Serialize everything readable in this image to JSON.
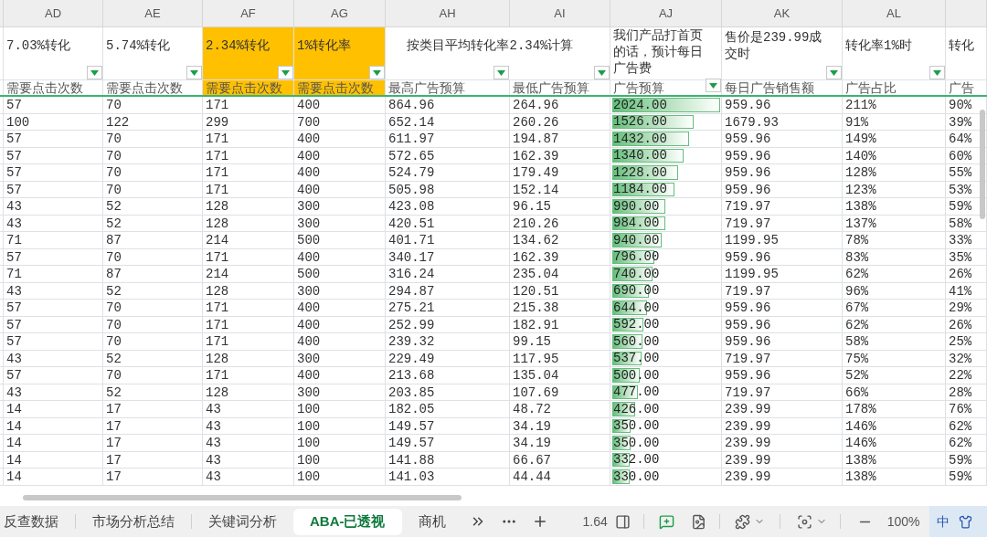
{
  "columns": [
    {
      "letter": "AD",
      "subheader": "需要点击次数",
      "filter": true,
      "highlighted": false,
      "kind": "text"
    },
    {
      "letter": "AE",
      "subheader": "需要点击次数",
      "filter": true,
      "highlighted": false,
      "kind": "text"
    },
    {
      "letter": "AF",
      "subheader": "需要点击次数",
      "filter": true,
      "highlighted": true,
      "kind": "text"
    },
    {
      "letter": "AG",
      "subheader": "需要点击次数",
      "filter": true,
      "highlighted": true,
      "kind": "text"
    },
    {
      "letter": "AH",
      "subheader": "最高广告预算",
      "filter": true,
      "highlighted": false,
      "kind": "text"
    },
    {
      "letter": "AI",
      "subheader": "最低广告预算",
      "filter": true,
      "highlighted": false,
      "kind": "text"
    },
    {
      "letter": "AJ",
      "subheader": "广告预算",
      "filter": true,
      "highlighted": false,
      "kind": "databar"
    },
    {
      "letter": "AK",
      "subheader": "每日广告销售额",
      "filter": true,
      "highlighted": false,
      "kind": "text"
    },
    {
      "letter": "AL",
      "subheader": "广告占比",
      "filter": true,
      "highlighted": false,
      "kind": "text"
    },
    {
      "subheader": "广告",
      "filter": false,
      "highlighted": false,
      "kind": "text"
    }
  ],
  "header_cells": [
    {
      "text": "7.03%转化",
      "kind": "single"
    },
    {
      "text": "5.74%转化",
      "kind": "single"
    },
    {
      "text": "2.34%转化",
      "kind": "single"
    },
    {
      "text": "1%转化率",
      "kind": "single"
    },
    {
      "text": "按类目平均转化率2.34%计算",
      "kind": "merged"
    },
    {
      "text": "我们产品打首页的话，预计每日广告费",
      "kind": "single"
    },
    {
      "text": "售价是239.99成交时",
      "kind": "single"
    },
    {
      "text": "转化率1%时",
      "kind": "single"
    },
    {
      "text": "转化",
      "kind": "single"
    }
  ],
  "rows": [
    [
      "57",
      "70",
      "171",
      "400",
      "864.96",
      "264.96",
      {
        "text": "2024.00",
        "level": 1.0
      },
      "959.96",
      "211%",
      "90%"
    ],
    [
      "100",
      "122",
      "299",
      "700",
      "652.14",
      "260.26",
      {
        "text": "1526.00",
        "level": 0.75
      },
      "1679.93",
      "91%",
      "39%"
    ],
    [
      "57",
      "70",
      "171",
      "400",
      "611.97",
      "194.87",
      {
        "text": "1432.00",
        "level": 0.71
      },
      "959.96",
      "149%",
      "64%"
    ],
    [
      "57",
      "70",
      "171",
      "400",
      "572.65",
      "162.39",
      {
        "text": "1340.00",
        "level": 0.66
      },
      "959.96",
      "140%",
      "60%"
    ],
    [
      "57",
      "70",
      "171",
      "400",
      "524.79",
      "179.49",
      {
        "text": "1228.00",
        "level": 0.61
      },
      "959.96",
      "128%",
      "55%"
    ],
    [
      "57",
      "70",
      "171",
      "400",
      "505.98",
      "152.14",
      {
        "text": "1184.00",
        "level": 0.58
      },
      "959.96",
      "123%",
      "53%"
    ],
    [
      "43",
      "52",
      "128",
      "300",
      "423.08",
      "96.15",
      {
        "text": "990.00",
        "level": 0.49
      },
      "719.97",
      "138%",
      "59%"
    ],
    [
      "43",
      "52",
      "128",
      "300",
      "420.51",
      "210.26",
      {
        "text": "984.00",
        "level": 0.49
      },
      "719.97",
      "137%",
      "58%"
    ],
    [
      "71",
      "87",
      "214",
      "500",
      "401.71",
      "134.62",
      {
        "text": "940.00",
        "level": 0.46
      },
      "1199.95",
      "78%",
      "33%"
    ],
    [
      "57",
      "70",
      "171",
      "400",
      "340.17",
      "162.39",
      {
        "text": "796.00",
        "level": 0.39
      },
      "959.96",
      "83%",
      "35%"
    ],
    [
      "71",
      "87",
      "214",
      "500",
      "316.24",
      "235.04",
      {
        "text": "740.00",
        "level": 0.37
      },
      "1199.95",
      "62%",
      "26%"
    ],
    [
      "43",
      "52",
      "128",
      "300",
      "294.87",
      "120.51",
      {
        "text": "690.00",
        "level": 0.34
      },
      "719.97",
      "96%",
      "41%"
    ],
    [
      "57",
      "70",
      "171",
      "400",
      "275.21",
      "215.38",
      {
        "text": "644.00",
        "level": 0.32
      },
      "959.96",
      "67%",
      "29%"
    ],
    [
      "57",
      "70",
      "171",
      "400",
      "252.99",
      "182.91",
      {
        "text": "592.00",
        "level": 0.29
      },
      "959.96",
      "62%",
      "26%"
    ],
    [
      "57",
      "70",
      "171",
      "400",
      "239.32",
      "99.15",
      {
        "text": "560.00",
        "level": 0.28
      },
      "959.96",
      "58%",
      "25%"
    ],
    [
      "43",
      "52",
      "128",
      "300",
      "229.49",
      "117.95",
      {
        "text": "537.00",
        "level": 0.27
      },
      "719.97",
      "75%",
      "32%"
    ],
    [
      "57",
      "70",
      "171",
      "400",
      "213.68",
      "135.04",
      {
        "text": "500.00",
        "level": 0.25
      },
      "959.96",
      "52%",
      "22%"
    ],
    [
      "43",
      "52",
      "128",
      "300",
      "203.85",
      "107.69",
      {
        "text": "477.00",
        "level": 0.24
      },
      "719.97",
      "66%",
      "28%"
    ],
    [
      "14",
      "17",
      "43",
      "100",
      "182.05",
      "48.72",
      {
        "text": "426.00",
        "level": 0.21
      },
      "239.99",
      "178%",
      "76%"
    ],
    [
      "14",
      "17",
      "43",
      "100",
      "149.57",
      "34.19",
      {
        "text": "350.00",
        "level": 0.17
      },
      "239.99",
      "146%",
      "62%"
    ],
    [
      "14",
      "17",
      "43",
      "100",
      "149.57",
      "34.19",
      {
        "text": "350.00",
        "level": 0.17
      },
      "239.99",
      "146%",
      "62%"
    ],
    [
      "14",
      "17",
      "43",
      "100",
      "141.88",
      "66.67",
      {
        "text": "332.00",
        "level": 0.16
      },
      "239.99",
      "138%",
      "59%"
    ],
    [
      "14",
      "17",
      "43",
      "100",
      "141.03",
      "44.44",
      {
        "text": "330.00",
        "level": 0.16
      },
      "239.99",
      "138%",
      "59%"
    ]
  ],
  "sheet_tabs": [
    {
      "label": "反查数据",
      "selected": false
    },
    {
      "label": "市场分析总结",
      "selected": false
    },
    {
      "label": "关键词分析",
      "selected": false
    },
    {
      "label": "ABA-已透视",
      "selected": true
    },
    {
      "label": "商机",
      "selected": false
    }
  ],
  "status_bar": {
    "page_value": "1.64",
    "zoom": "100%",
    "input_method": "中"
  }
}
